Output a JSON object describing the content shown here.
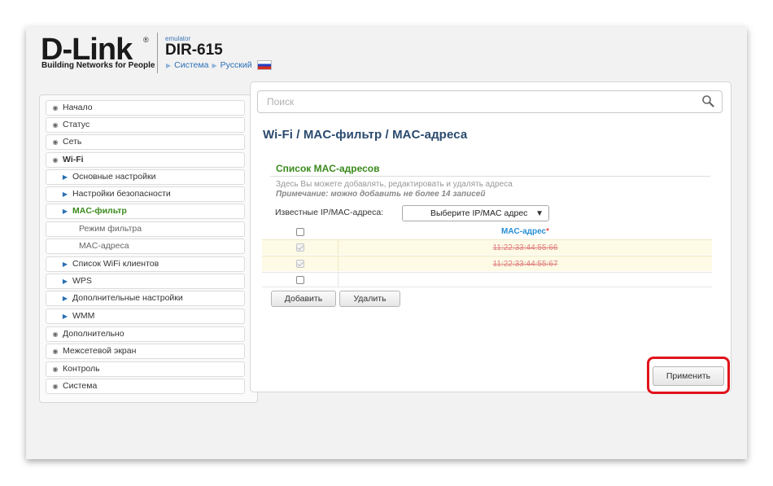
{
  "header": {
    "logo": "D-Link",
    "logo_reg": "®",
    "tagline": "Building Networks for People",
    "emulator": "emulator",
    "model": "DIR-615",
    "breadcrumb": [
      "Система",
      "Русский"
    ],
    "flag": "russia-flag"
  },
  "search": {
    "placeholder": "Поиск",
    "icon": "search-icon"
  },
  "sidebar": {
    "items": [
      {
        "label": "Начало",
        "icon": "chevron-right-circle-icon",
        "level": 1
      },
      {
        "label": "Статус",
        "icon": "chevron-right-circle-icon",
        "level": 1
      },
      {
        "label": "Сеть",
        "icon": "chevron-right-circle-icon",
        "level": 1
      },
      {
        "label": "Wi-Fi",
        "icon": "chevron-down-circle-icon",
        "level": 1,
        "expanded": true
      },
      {
        "label": "Основные настройки",
        "icon": "arrow-right-icon",
        "level": 2
      },
      {
        "label": "Настройки безопасности",
        "icon": "arrow-right-icon",
        "level": 2
      },
      {
        "label": "MAC-фильтр",
        "icon": "arrow-right-icon",
        "level": 2,
        "active": true
      },
      {
        "label": "Режим фильтра",
        "level": 3
      },
      {
        "label": "MAC-адреса",
        "level": 3
      },
      {
        "label": "Список WiFi клиентов",
        "icon": "arrow-right-icon",
        "level": 2
      },
      {
        "label": "WPS",
        "icon": "arrow-right-icon",
        "level": 2
      },
      {
        "label": "Дополнительные настройки",
        "icon": "arrow-right-icon",
        "level": 2
      },
      {
        "label": "WMM",
        "icon": "arrow-right-icon",
        "level": 2
      },
      {
        "label": "Дополнительно",
        "icon": "chevron-right-circle-icon",
        "level": 1
      },
      {
        "label": "Межсетевой экран",
        "icon": "chevron-right-circle-icon",
        "level": 1
      },
      {
        "label": "Контроль",
        "icon": "chevron-right-circle-icon",
        "level": 1
      },
      {
        "label": "Система",
        "icon": "chevron-right-circle-icon",
        "level": 1
      }
    ]
  },
  "main": {
    "title": "Wi-Fi /  MAC-фильтр /  MAC-адреса",
    "section_title": "Список MAC-адресов",
    "description": "Здесь Вы можете добавлять, редактировать и удалять адреса",
    "note": "Примечание: можно добавить не более 14 записей",
    "known_label": "Известные IP/MAC-адреса:",
    "known_select": "Выберите IP/MAC адрес",
    "table": {
      "header": "MAC-адрес",
      "required_mark": "*",
      "rows": [
        {
          "mac": "11:22:33:44:55:66",
          "checked": true,
          "disabled": true
        },
        {
          "mac": "11:22:33:44:55:67",
          "checked": true,
          "disabled": true
        },
        {
          "mac": "",
          "checked": false,
          "disabled": false
        }
      ]
    },
    "add_label": "Добавить",
    "delete_label": "Удалить",
    "apply_label": "Применить"
  },
  "colors": {
    "accent_green": "#3a8a1c",
    "title_blue": "#2a4a6e",
    "link_blue": "#2a6fb5",
    "highlight_red": "#e0131b",
    "strike_red": "#e08080"
  }
}
